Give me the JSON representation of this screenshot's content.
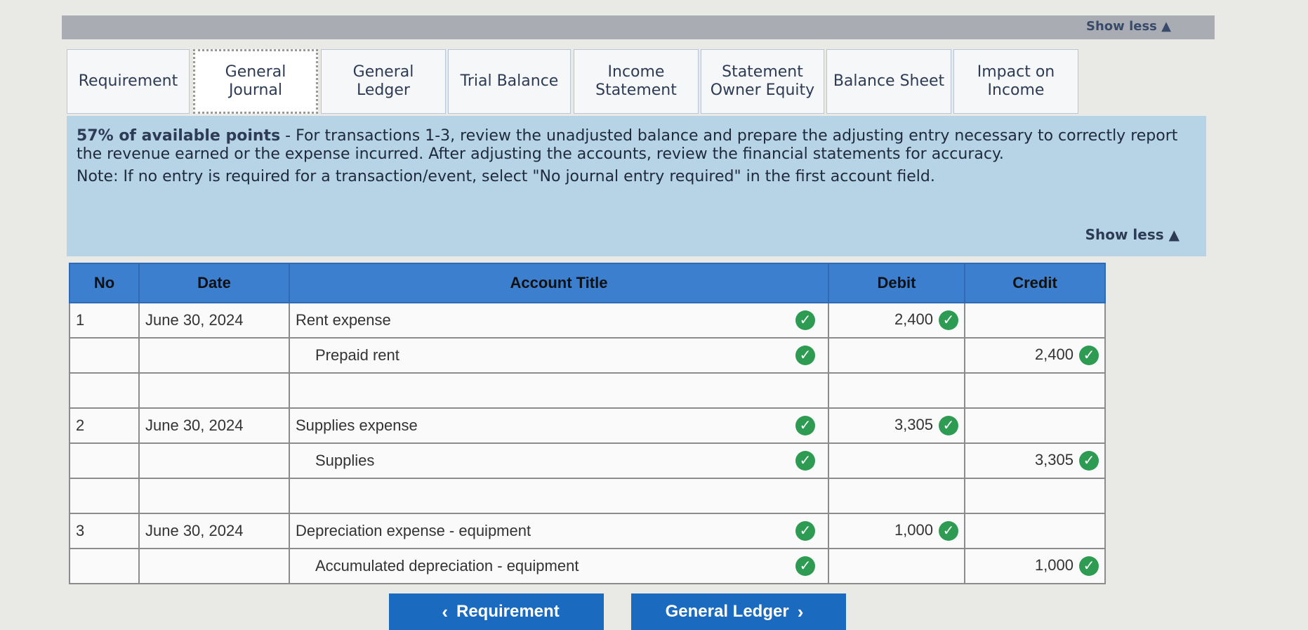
{
  "header": {
    "show_less_top": "Show less ▲"
  },
  "tabs": [
    {
      "label": "Requirement"
    },
    {
      "label": "General\nJournal"
    },
    {
      "label": "General\nLedger"
    },
    {
      "label": "Trial Balance"
    },
    {
      "label": "Income\nStatement"
    },
    {
      "label": "Statement\nOwner Equity"
    },
    {
      "label": "Balance Sheet"
    },
    {
      "label": "Impact on\nIncome"
    }
  ],
  "panel": {
    "points": "57% of available points",
    "instructions": " - For transactions 1-3, review the unadjusted balance and prepare the adjusting entry necessary to correctly report the revenue earned or the expense incurred.  After adjusting the accounts, review the financial statements for accuracy.",
    "note": "Note: If no entry is required for a transaction/event, select \"No journal entry required\" in the first account field.",
    "show_less": "Show less ▲"
  },
  "table": {
    "headers": {
      "no": "No",
      "date": "Date",
      "account": "Account Title",
      "debit": "Debit",
      "credit": "Credit"
    },
    "rows": [
      {
        "no": "1",
        "date": "June 30, 2024",
        "account": "Rent expense",
        "debit": "2,400",
        "credit": ""
      },
      {
        "no": "",
        "date": "",
        "account": "Prepaid rent",
        "debit": "",
        "credit": "2,400"
      },
      {
        "no": "",
        "date": "",
        "account": "",
        "debit": "",
        "credit": ""
      },
      {
        "no": "2",
        "date": "June 30, 2024",
        "account": "Supplies expense",
        "debit": "3,305",
        "credit": ""
      },
      {
        "no": "",
        "date": "",
        "account": "Supplies",
        "debit": "",
        "credit": "3,305"
      },
      {
        "no": "",
        "date": "",
        "account": "",
        "debit": "",
        "credit": ""
      },
      {
        "no": "3",
        "date": "June 30, 2024",
        "account": "Depreciation expense - equipment",
        "debit": "1,000",
        "credit": ""
      },
      {
        "no": "",
        "date": "",
        "account": "Accumulated depreciation - equipment",
        "debit": "",
        "credit": "1,000"
      }
    ]
  },
  "nav": {
    "prev_label": "Requirement",
    "next_label": "General Ledger"
  },
  "colors": {
    "accent": "#1a6bbf",
    "check": "#2e9b52",
    "panel": "#b6d4e6"
  }
}
